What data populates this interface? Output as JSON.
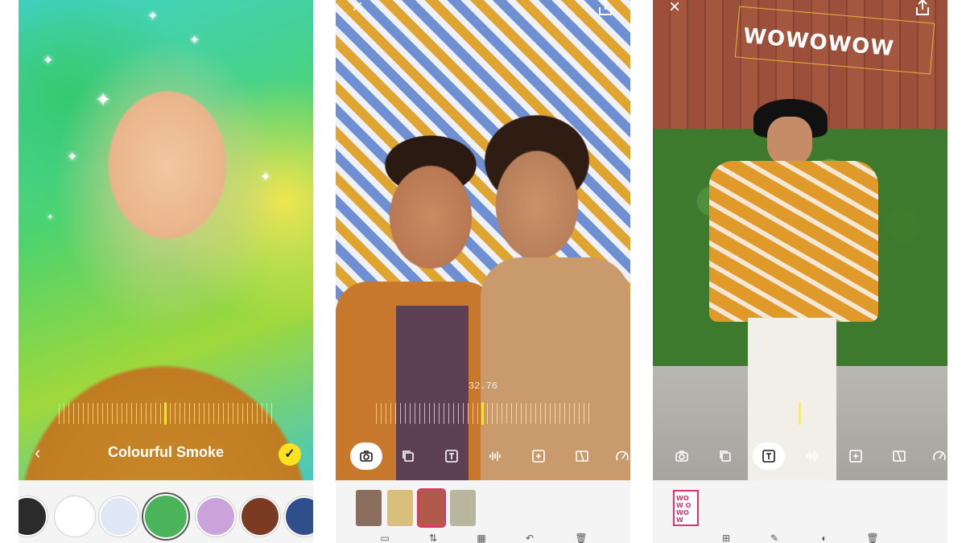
{
  "screen1": {
    "filter_name": "Colourful Smoke",
    "back_icon": "chevron-left-icon",
    "confirm_icon": "checkmark-icon",
    "face_filters": [
      {
        "name": "black-face-filter",
        "color": "#2b2b2b"
      },
      {
        "name": "white-face-filter",
        "color": "#ffffff"
      },
      {
        "name": "snow-face-filter",
        "color": "#dfe8f4"
      },
      {
        "name": "smoke-filter",
        "color": "#4bb35a"
      },
      {
        "name": "glitch-filter",
        "color": "#c9a3d9"
      },
      {
        "name": "brown-face-filter",
        "color": "#7a3b22"
      },
      {
        "name": "blue-filter",
        "color": "#2f4e8c"
      }
    ]
  },
  "screen2": {
    "time_readout": "32.76",
    "toolbar": [
      "camera-icon",
      "duplicate-icon",
      "text-icon",
      "audio-icon",
      "add-clip-icon",
      "split-icon",
      "speed-icon"
    ],
    "clips": [
      {
        "name": "clip-selfie-duo",
        "color": "#8a6d5c"
      },
      {
        "name": "clip-woman",
        "color": "#d8c07c"
      },
      {
        "name": "clip-wall",
        "color": "#b25a4a"
      },
      {
        "name": "clip-man",
        "color": "#b8b69e"
      }
    ]
  },
  "screen3": {
    "sticker_text": "WOWOWOW",
    "text_clip": "WOW OWO W",
    "toolbar": [
      "camera-icon",
      "duplicate-icon",
      "text-icon",
      "audio-icon",
      "add-clip-icon",
      "split-icon",
      "speed-icon"
    ],
    "active_tool": "text-icon"
  },
  "colors": {
    "accent_yellow": "#ffe21f",
    "accent_pink": "#e1306c"
  }
}
